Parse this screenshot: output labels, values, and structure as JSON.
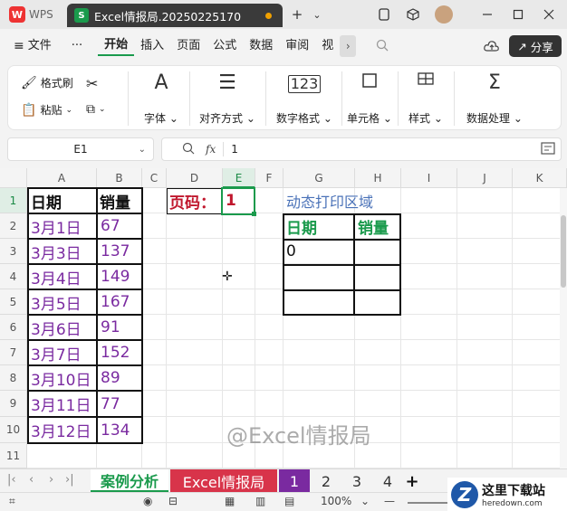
{
  "titlebar": {
    "app_label": "WPS",
    "file_tab_icon": "S",
    "file_tab_title": "Excel情报局.20250225170",
    "new_tab": "+",
    "chevron": "⌄"
  },
  "menu": {
    "file": "文件",
    "more": "···",
    "items": [
      "开始",
      "插入",
      "页面",
      "公式",
      "数据",
      "审阅",
      "视"
    ],
    "share": "分享"
  },
  "ribbon": {
    "format_painter": "格式刷",
    "paste": "粘贴",
    "font": "字体",
    "align": "对齐方式",
    "number_format": "数字格式",
    "cell": "单元格",
    "style": "样式",
    "data_process": "数据处理"
  },
  "formula_bar": {
    "name_box": "E1",
    "fx": "fx",
    "value": "1"
  },
  "grid": {
    "columns": [
      "A",
      "B",
      "C",
      "D",
      "E",
      "F",
      "G",
      "H",
      "I",
      "J",
      "K"
    ],
    "rows": [
      "1",
      "2",
      "3",
      "4",
      "5",
      "6",
      "7",
      "8",
      "9",
      "10",
      "11"
    ],
    "header_date": "日期",
    "header_sales": "销量",
    "dates": [
      "3月1日",
      "3月3日",
      "3月4日",
      "3月5日",
      "3月6日",
      "3月7日",
      "3月10日",
      "3月11日",
      "3月12日"
    ],
    "sales": [
      "67",
      "137",
      "149",
      "167",
      "91",
      "152",
      "89",
      "77",
      "134"
    ],
    "page_label": "页码：",
    "page_value": "1",
    "dynamic_title": "动态打印区域",
    "dyn_header_date": "日期",
    "dyn_header_sales": "销量",
    "dyn_value": "0",
    "watermark": "@Excel情报局"
  },
  "sheets": {
    "tabs": [
      "案例分析",
      "Excel情报局",
      "1",
      "2",
      "3",
      "4"
    ],
    "add": "+"
  },
  "status": {
    "zoom": "100%",
    "minus": "—"
  },
  "corner_logo": {
    "mark": "Z",
    "title": "这里下载站",
    "url": "heredown.com"
  },
  "colors": {
    "accent_green": "#1a9a4c",
    "purple_text": "#7a2aa0",
    "red_text": "#c0172d",
    "sheet_tab_red": "#d8344a",
    "sheet_tab_purple": "#7a2aa0"
  }
}
